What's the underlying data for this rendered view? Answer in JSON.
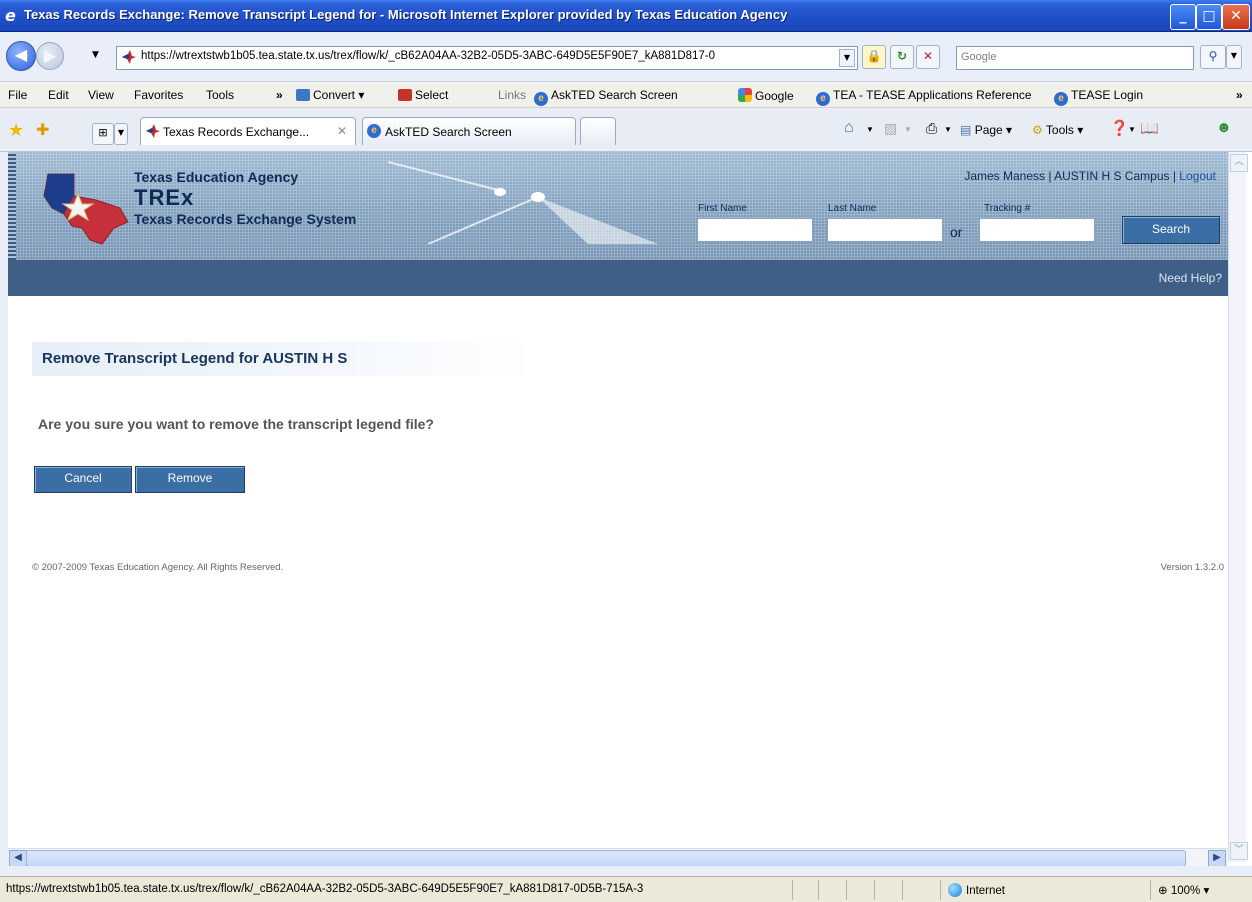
{
  "window": {
    "title": "Texas Records Exchange: Remove Transcript Legend for - Microsoft Internet Explorer provided by Texas Education Agency"
  },
  "address_bar": {
    "url": "https://wtrextstwb1b05.tea.state.tx.us/trex/flow/k/_cB62A04AA-32B2-05D5-3ABC-649D5E5F90E7_kA881D817-0",
    "search_placeholder": "Google"
  },
  "menu": {
    "file": "File",
    "edit": "Edit",
    "view": "View",
    "favorites": "Favorites",
    "tools": "Tools",
    "overflow": "»",
    "convert": "Convert",
    "select": "Select",
    "links_label": "Links",
    "links": [
      "AskTED Search Screen",
      "Google",
      "TEA - TEASE Applications Reference",
      "TEASE Login"
    ],
    "right_overflow": "»"
  },
  "tabs": [
    {
      "label": "Texas Records Exchange...",
      "active": true
    },
    {
      "label": "AskTED Search Screen",
      "active": false
    }
  ],
  "command_bar": {
    "page": "Page",
    "tools": "Tools"
  },
  "site_header": {
    "agency": "Texas Education Agency",
    "product": "TREx",
    "system": "Texas Records Exchange System",
    "user_text": "James Maness | AUSTIN H S Campus |",
    "logout": "Logout",
    "first_name_label": "First Name",
    "last_name_label": "Last Name",
    "or_label": "or",
    "tracking_label": "Tracking #",
    "search_button": "Search",
    "help_link": "Need Help?"
  },
  "main": {
    "page_title": "Remove Transcript Legend for AUSTIN H S",
    "question": "Are you sure you want to remove the transcript legend file?",
    "cancel_button": "Cancel",
    "remove_button": "Remove"
  },
  "footer": {
    "copyright": "© 2007-2009 Texas Education Agency. All Rights Reserved.",
    "version": "Version 1.3.2.0"
  },
  "status_bar": {
    "url": "https://wtrextstwb1b05.tea.state.tx.us/trex/flow/k/_cB62A04AA-32B2-05D5-3ABC-649D5E5F90E7_kA881D817-0D5B-715A-3",
    "zone": "Internet",
    "zoom": "100%"
  },
  "colors": {
    "titlebar": "#1f4fc8",
    "header_bg": "#7d9cbb",
    "subnav_bg": "#3f5f86",
    "button_bg": "#3b6ea5",
    "title_text": "#1a3560"
  },
  "icons": [
    "ie-icon",
    "back-icon",
    "forward-icon",
    "favicon-texas",
    "lock-icon",
    "refresh-icon",
    "stop-icon",
    "search-go-icon",
    "favorites-star-icon",
    "add-favorites-icon",
    "quick-tabs-icon",
    "home-icon",
    "feeds-icon",
    "print-icon",
    "page-icon",
    "tools-gear-icon",
    "help-icon",
    "research-icon",
    "messenger-icon",
    "globe-icon",
    "zoom-icon"
  ]
}
